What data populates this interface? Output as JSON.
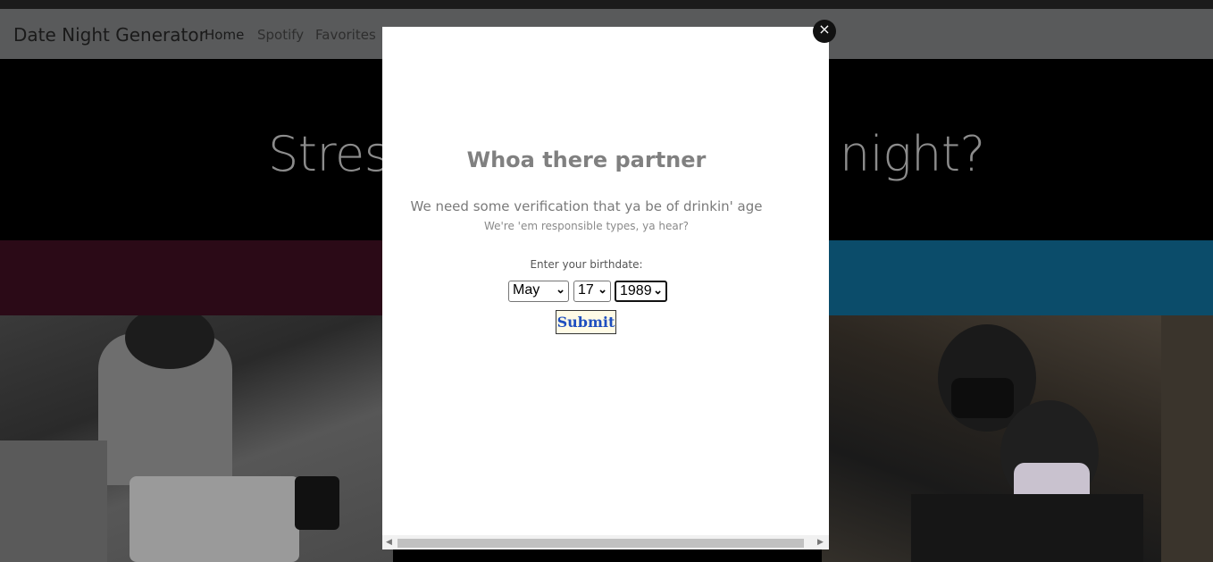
{
  "navbar": {
    "brand": "Date Night Generator",
    "links": [
      {
        "label": "Home",
        "color": "#1a1a1a"
      },
      {
        "label": "Spotify",
        "color": "#2e2e2e"
      },
      {
        "label": "Favorites",
        "color": "#2e2e2e"
      }
    ]
  },
  "hero": {
    "left_text": "Stress",
    "right_text": "night?"
  },
  "modal": {
    "close_label": "×",
    "title": "Whoa there partner",
    "subtitle": "We need some verification that ya be of drinkin' age",
    "note": "We're 'em responsible types, ya hear?",
    "birthdate_label": "Enter your birthdate:",
    "month": "May",
    "day": "17",
    "year": "1989",
    "submit_label": "Submit"
  },
  "icons": {
    "close": "close-icon",
    "chevron": "chevron-down-icon"
  }
}
